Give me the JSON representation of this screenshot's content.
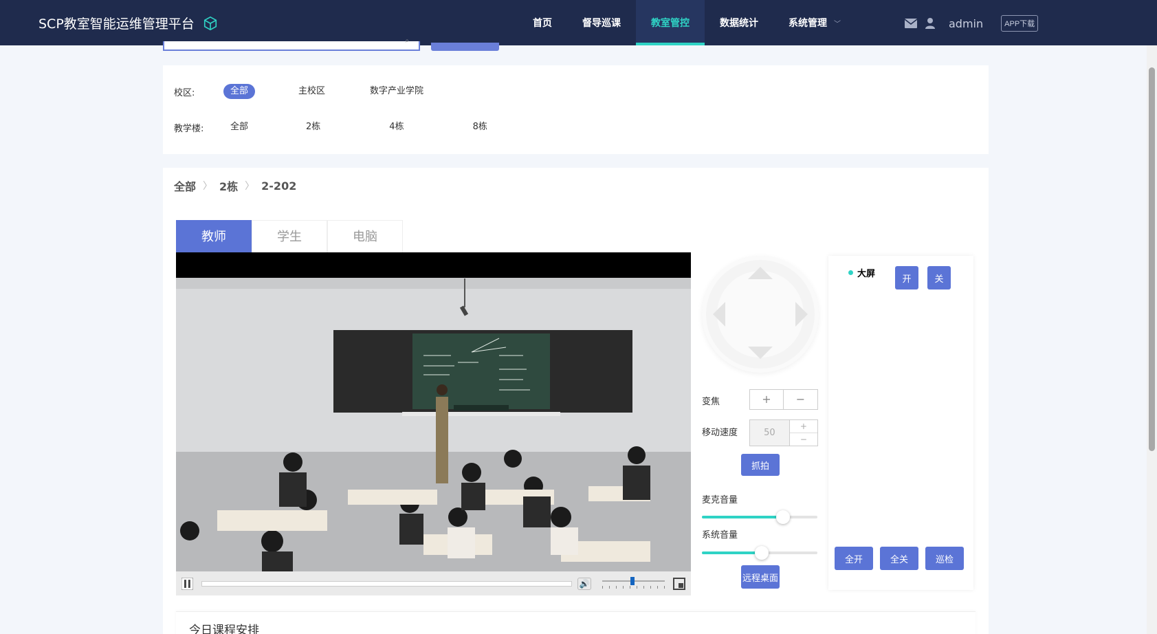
{
  "header": {
    "title": "SCP教室智能运维管理平台",
    "nav": [
      {
        "label": "首页",
        "active": false
      },
      {
        "label": "督导巡课",
        "active": false
      },
      {
        "label": "教室管控",
        "active": true
      },
      {
        "label": "数据统计",
        "active": false
      },
      {
        "label": "系统管理",
        "active": false
      }
    ],
    "user": "admin",
    "app_download": "APP下载"
  },
  "filters": {
    "campus_label": "校区:",
    "campus_options": [
      "全部",
      "主校区",
      "数字产业学院"
    ],
    "campus_selected": "全部",
    "building_label": "教学楼:",
    "building_options": [
      "全部",
      "2栋",
      "4栋",
      "8栋"
    ]
  },
  "breadcrumb": [
    "全部",
    "2栋",
    "2-202"
  ],
  "tabs": [
    {
      "label": "教师",
      "active": true
    },
    {
      "label": "学生",
      "active": false
    },
    {
      "label": "电脑",
      "active": false
    }
  ],
  "controls": {
    "zoom_label": "变焦",
    "zoom_plus": "+",
    "zoom_minus": "−",
    "speed_label": "移动速度",
    "speed_value": "50",
    "speed_plus": "+",
    "speed_minus": "−",
    "capture_label": "抓拍",
    "mic_volume_label": "麦克音量",
    "mic_volume": 0.7,
    "system_volume_label": "系统音量",
    "system_volume": 0.52,
    "player_volume": 0.48,
    "remote_desktop_label": "远程桌面"
  },
  "devices": {
    "items": [
      {
        "name": "大屏",
        "on_label": "开",
        "off_label": "关"
      }
    ],
    "all_on_label": "全开",
    "all_off_label": "全关",
    "patrol_label": "巡检"
  },
  "schedule": {
    "title": "今日课程安排"
  },
  "colors": {
    "nav_bg": "#1f2b4d",
    "accent": "#2fd3c5",
    "primary": "#5b74d6"
  }
}
